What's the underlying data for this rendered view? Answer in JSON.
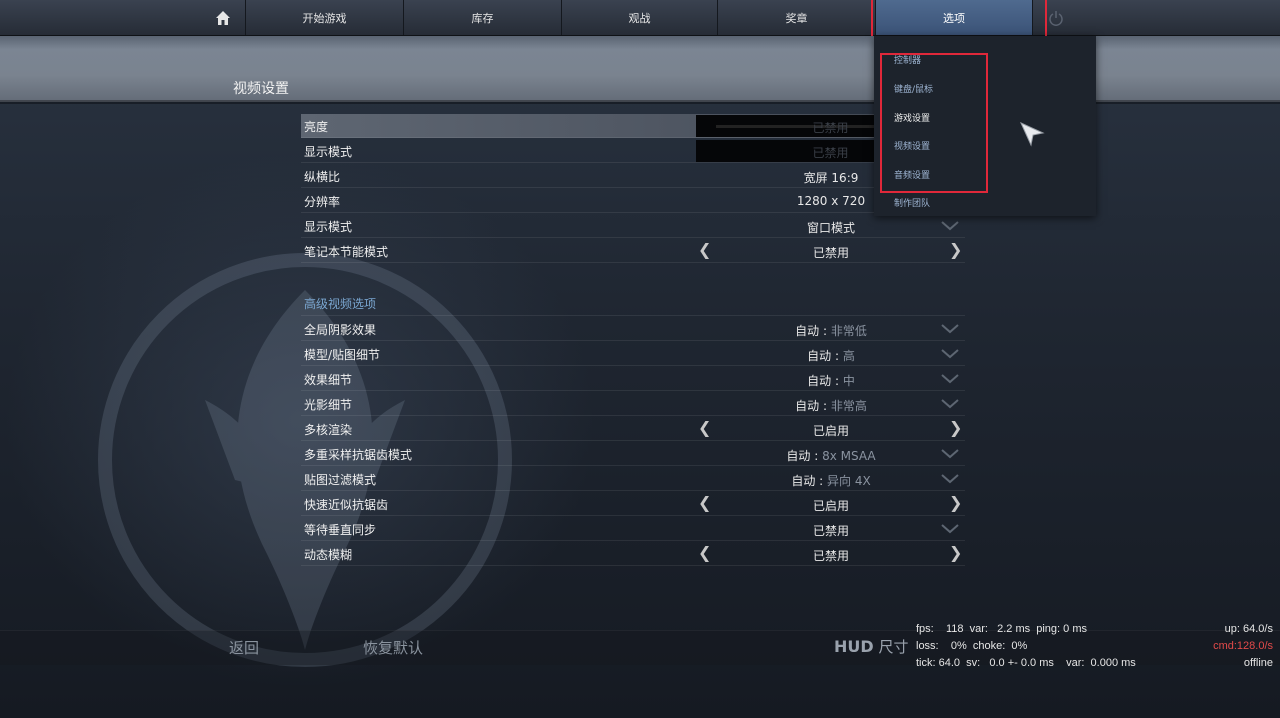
{
  "nav": {
    "home_icon": "home-icon",
    "items": [
      "开始游戏",
      "库存",
      "观战",
      "奖章",
      "选项"
    ],
    "power_icon": "power-icon"
  },
  "page": {
    "title": "视频设置"
  },
  "dropdown": {
    "items": [
      "控制器",
      "键盘/鼠标",
      "游戏设置",
      "视频设置",
      "音频设置",
      "制作团队"
    ]
  },
  "settings": {
    "basic": [
      {
        "label": "亮度",
        "value": "已禁用",
        "control": "slider"
      },
      {
        "label": "显示模式",
        "value": "已禁用",
        "control": "field"
      },
      {
        "label": "纵横比",
        "value": "宽屏 16:9",
        "control": "dropdown"
      },
      {
        "label": "分辨率",
        "value": "1280 x 720",
        "control": "dropdown"
      },
      {
        "label": "显示模式",
        "value": "窗口模式",
        "control": "dropdown"
      },
      {
        "label": "笔记本节能模式",
        "value": "已禁用",
        "control": "toggle"
      }
    ],
    "advanced_title": "高级视频选项",
    "advanced": [
      {
        "label": "全局阴影效果",
        "prefix": "自动 : ",
        "value": "非常低",
        "control": "dropdown"
      },
      {
        "label": "模型/贴图细节",
        "prefix": "自动 : ",
        "value": "高",
        "control": "dropdown"
      },
      {
        "label": "效果细节",
        "prefix": "自动 : ",
        "value": "中",
        "control": "dropdown"
      },
      {
        "label": "光影细节",
        "prefix": "自动 : ",
        "value": "非常高",
        "control": "dropdown"
      },
      {
        "label": "多核渲染",
        "prefix": "",
        "value": "已启用",
        "control": "toggle"
      },
      {
        "label": "多重采样抗锯齿模式",
        "prefix": "自动 : ",
        "value": "8x MSAA",
        "control": "dropdown"
      },
      {
        "label": "贴图过滤模式",
        "prefix": "自动 : ",
        "value": "异向 4X",
        "control": "dropdown"
      },
      {
        "label": "快速近似抗锯齿",
        "prefix": "",
        "value": "已启用",
        "control": "toggle"
      },
      {
        "label": "等待垂直同步",
        "prefix": "",
        "value": "已禁用",
        "control": "dropdown"
      },
      {
        "label": "动态模糊",
        "prefix": "",
        "value": "已禁用",
        "control": "toggle"
      }
    ]
  },
  "bottom": {
    "back": "返回",
    "reset": "恢复默认",
    "hud_bold": "HUD",
    "hud_rest": " 尺寸"
  },
  "netgraph": {
    "line1": "fps:    118  var:   2.2 ms  ping: 0 ms",
    "line2": "loss:    0%  choke:  0%",
    "line3": "tick: 64.0  sv:   0.0 +- 0.0 ms    var:  0.000 ms",
    "up": "up: 64.0/s",
    "cmd": "cmd:128.0/s",
    "status": "offline"
  },
  "colors": {
    "highlight_border": "#e0283a",
    "nav_active": "#4f6a8f",
    "section_title": "#7aa6d0",
    "cmd_text": "#e24a4a"
  }
}
